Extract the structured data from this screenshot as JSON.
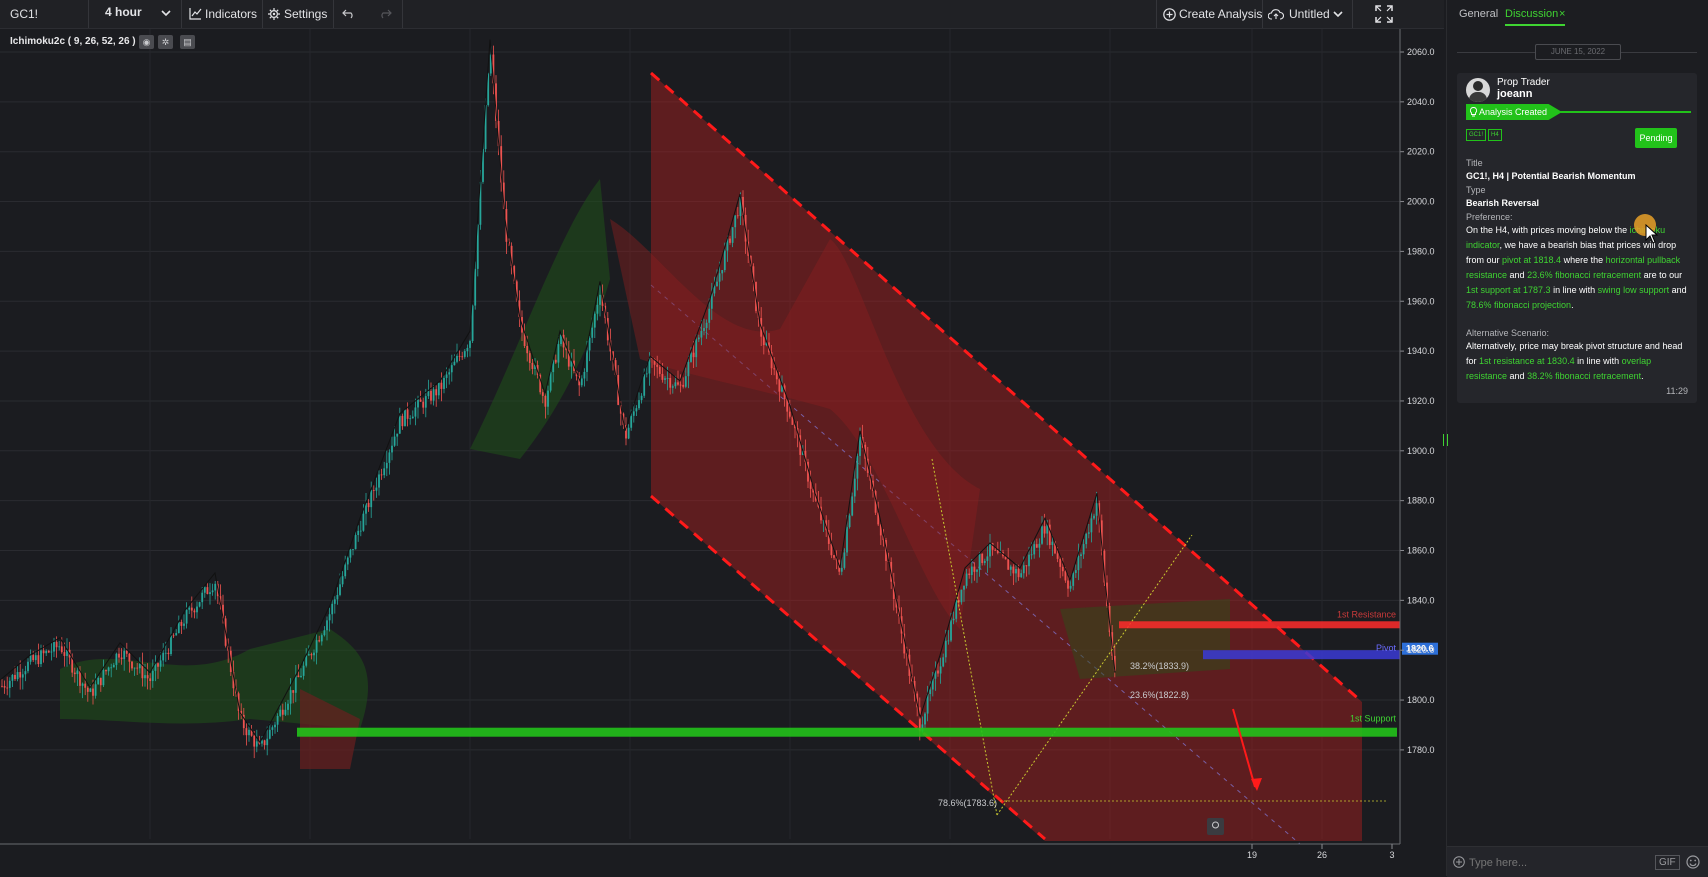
{
  "toolbar": {
    "symbol": "GC1!",
    "timeframe": "4 hour",
    "indicators_label": "Indicators",
    "settings_label": "Settings",
    "create_analysis_label": "Create Analysis",
    "layout_name": "Untitled"
  },
  "legend": {
    "indicator": "Ichimoku2c ( 9, 26, 52, 26 )"
  },
  "colors": {
    "bg": "#1b1c20",
    "up": "#26a69a",
    "down": "#ef5350",
    "channel": "#b2201e",
    "accent": "#3fd432",
    "resistance": "#ff2b2b",
    "pivot": "#3a3ad6",
    "support": "#22c21a"
  },
  "chart_data": {
    "type": "candlestick",
    "symbol": "GC1!",
    "timeframe": "4 hour",
    "ylim": [
      1772,
      2067
    ],
    "y_ticks": [
      2060.0,
      2040.0,
      2020.0,
      2000.0,
      1980.0,
      1960.0,
      1940.0,
      1920.0,
      1900.0,
      1880.0,
      1860.0,
      1840.0,
      1820.0,
      1800.0,
      1780.0
    ],
    "x_tick_labels": [
      "19",
      "26",
      "3"
    ],
    "price_path": [
      [
        0,
        1805
      ],
      [
        30,
        1815
      ],
      [
        60,
        1822
      ],
      [
        90,
        1802
      ],
      [
        120,
        1820
      ],
      [
        150,
        1808
      ],
      [
        185,
        1833
      ],
      [
        215,
        1848
      ],
      [
        240,
        1792
      ],
      [
        260,
        1780
      ],
      [
        300,
        1810
      ],
      [
        330,
        1835
      ],
      [
        360,
        1870
      ],
      [
        400,
        1912
      ],
      [
        440,
        1925
      ],
      [
        470,
        1945
      ],
      [
        490,
        2062
      ],
      [
        505,
        1990
      ],
      [
        520,
        1950
      ],
      [
        545,
        1920
      ],
      [
        560,
        1945
      ],
      [
        580,
        1925
      ],
      [
        600,
        1965
      ],
      [
        625,
        1905
      ],
      [
        650,
        1935
      ],
      [
        680,
        1925
      ],
      [
        710,
        1958
      ],
      [
        740,
        2000
      ],
      [
        760,
        1948
      ],
      [
        790,
        1915
      ],
      [
        815,
        1880
      ],
      [
        840,
        1850
      ],
      [
        860,
        1905
      ],
      [
        880,
        1870
      ],
      [
        905,
        1820
      ],
      [
        920,
        1790
      ],
      [
        940,
        1815
      ],
      [
        965,
        1850
      ],
      [
        990,
        1860
      ],
      [
        1020,
        1850
      ],
      [
        1045,
        1870
      ],
      [
        1070,
        1845
      ],
      [
        1097,
        1880
      ],
      [
        1105,
        1845
      ],
      [
        1115,
        1808
      ]
    ],
    "labels": {
      "resistance": "1st Resistance",
      "pivot": "Pivot",
      "support": "1st Support",
      "fib_38": "38.2%(1833.9)",
      "fib_23": "23.6%(1822.8)",
      "fib_78": "78.6%(1783.6)",
      "last_price": "1820.6"
    },
    "levels": {
      "resistance": 1830.4,
      "pivot": 1818.4,
      "support": 1787.3,
      "last_price": 1820.6
    }
  },
  "panel": {
    "tab_general": "General",
    "tab_discussion": "Discussion",
    "close_tab": "×",
    "date_divider": "JUNE 15, 2022",
    "author_role": "Prop Trader",
    "author_name": "joeann",
    "status_banner": "Analysis Created",
    "tag_symbol": "GC1!",
    "tag_tf": "H4",
    "pending_label": "Pending",
    "title_label": "Title",
    "title_value": "GC1!, H4 | Potential Bearish Momentum",
    "type_label": "Type",
    "type_value": "Bearish Reversal",
    "preference_label": "Preference:",
    "preference_text_1": "On the H4, with prices moving below the ",
    "preference_hl_1": "ichimoku indicator",
    "preference_text_2": ", we have a bearish bias that prices will drop from our ",
    "preference_hl_2": "pivot at 1818.4",
    "preference_text_3": " where the ",
    "preference_hl_3": "horizontal pullback resistance",
    "preference_text_4": " and ",
    "preference_hl_4": "23.6% fibonacci retracement",
    "preference_text_5": " are to our ",
    "preference_hl_5": "1st support  at 1787.3",
    "preference_text_6": " in line with ",
    "preference_hl_6": "swing low support",
    "preference_text_7": " and ",
    "preference_hl_7": "78.6% fibonacci projection",
    "preference_text_8": ".",
    "alt_label": "Alternative Scenario:",
    "alt_text_1": "Alternatively, price may break pivot structure and head for ",
    "alt_hl_1": "1st resistance at 1830.4",
    "alt_text_2": " in line with ",
    "alt_hl_2": "overlap resistance",
    "alt_text_3": " and ",
    "alt_hl_3": "38.2% fibonacci retracement",
    "alt_text_4": ".",
    "timestamp": "11:29",
    "chat_placeholder": "Type here...",
    "gif_label": "GIF"
  }
}
